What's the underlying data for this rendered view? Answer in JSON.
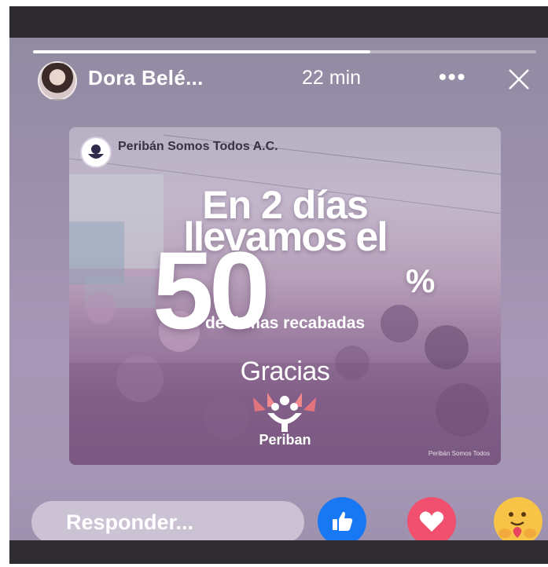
{
  "story": {
    "progress": 0.67
  },
  "header": {
    "user_name": "Dora Belé...",
    "time_ago": "22 min",
    "more_label": "•••"
  },
  "post": {
    "page_name": "Peribán Somos Todos A.C.",
    "line1": "En 2 días",
    "line2": "llevamos el",
    "big_number": "50",
    "percent_sign": "%",
    "subline": "de firmas recabadas",
    "thanks": "Gracias",
    "logo_name": "Periban",
    "watermark": "Peribán Somos Todos"
  },
  "footer": {
    "reply_placeholder": "Responder..."
  },
  "reactions": [
    {
      "name": "like",
      "icon": "thumbs-up-icon",
      "color": "#1877f2"
    },
    {
      "name": "love",
      "icon": "heart-icon",
      "color": "#f0506e"
    },
    {
      "name": "care",
      "icon": "care-emoji-icon",
      "color": "#f7c447"
    }
  ]
}
